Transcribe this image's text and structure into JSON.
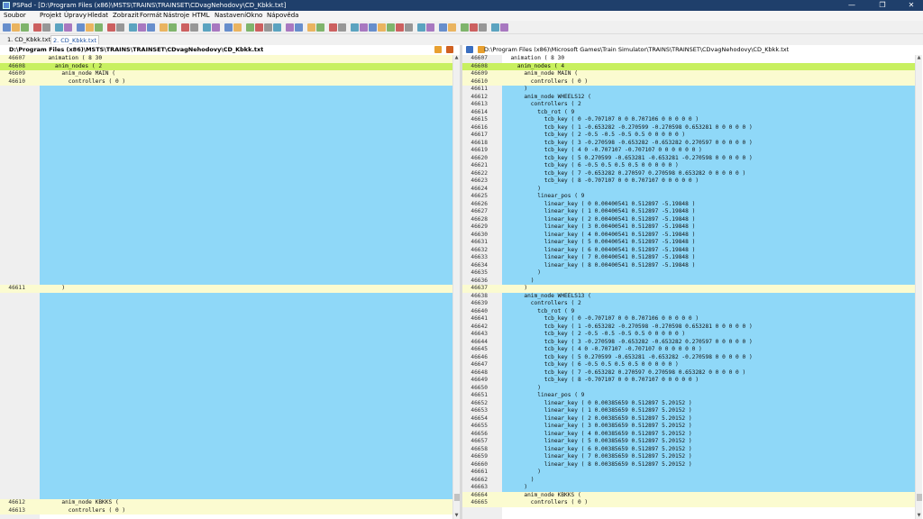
{
  "window": {
    "app_name": "PSPad",
    "title": "PSPad - [D:\\Program Files (x86)\\MSTS\\TRAINS\\TRAINSET\\CDvagNehodovy\\CD_Kbkk.txt]",
    "minimize": "—",
    "maximize": "❐",
    "close": "✕"
  },
  "menu": [
    "Soubor",
    "Projekt",
    "Úpravy",
    "Hledat",
    "Zobrazit",
    "Formát",
    "Nástroje",
    "HTML",
    "Nastavení",
    "Okno",
    "Nápověda"
  ],
  "toolbar_icons": [
    "new-file-icon",
    "open-file-icon",
    "save-icon",
    "save-all-icon",
    "print-icon",
    "print-preview-icon",
    "copy-icon",
    "paste-icon",
    "cut-icon",
    "find-icon",
    "replace-icon",
    "wrap-icon",
    "comment-icon",
    "uncomment-icon",
    "indent-icon",
    "outdent-icon",
    "ftp-icon",
    "browser-icon",
    "bookmark-icon",
    "delete-icon",
    "undo-icon",
    "redo-icon",
    "code-icon",
    "tool-icon",
    "star-icon",
    "column-icon",
    "macro-icon",
    "trans-icon",
    "case-icon",
    "format-icon",
    "clip-icon",
    "link-icon",
    "compare-icon",
    "sync-icon",
    "nav-icon",
    "book-icon",
    "color-icon",
    "grid-icon",
    "spell-icon",
    "script-icon",
    "file-icon",
    "send-icon",
    "lock-icon",
    "unlock-icon",
    "table-icon",
    "fold-icon",
    "unfold-icon",
    "check-icon",
    "run-icon"
  ],
  "tabs": [
    {
      "label": "1. CD_Kbkk.txt",
      "active": false
    },
    {
      "label": "2. CD_Kbkk.txt",
      "active": true
    }
  ],
  "colors": {
    "blue": "#8fd8f8",
    "green": "#c8f060",
    "yellow": "#fbfbd0",
    "white": "#ffffff"
  },
  "left_pane": {
    "path": "D:\\Program Files (x86)\\MSTS\\TRAINS\\TRAINSET\\CDvagNehodovy\\CD_Kbkk.txt",
    "rows": [
      {
        "n": "46607",
        "t": "  animation ( 8 30",
        "c": "yellow"
      },
      {
        "n": "46608",
        "t": "    anim_nodes ( 2",
        "c": "green"
      },
      {
        "n": "46609",
        "t": "      anim_node MAIN (",
        "c": "yellow"
      },
      {
        "n": "46610",
        "t": "        controllers ( 0 )",
        "c": "yellow"
      },
      {
        "n": "",
        "t": "",
        "c": "blue"
      },
      {
        "n": "",
        "t": "",
        "c": "blue"
      },
      {
        "n": "",
        "t": "",
        "c": "blue"
      },
      {
        "n": "",
        "t": "",
        "c": "blue"
      },
      {
        "n": "",
        "t": "",
        "c": "blue"
      },
      {
        "n": "",
        "t": "",
        "c": "blue"
      },
      {
        "n": "",
        "t": "",
        "c": "blue"
      },
      {
        "n": "",
        "t": "",
        "c": "blue"
      },
      {
        "n": "",
        "t": "",
        "c": "blue"
      },
      {
        "n": "",
        "t": "",
        "c": "blue"
      },
      {
        "n": "",
        "t": "",
        "c": "blue"
      },
      {
        "n": "",
        "t": "",
        "c": "blue"
      },
      {
        "n": "",
        "t": "",
        "c": "blue"
      },
      {
        "n": "",
        "t": "",
        "c": "blue"
      },
      {
        "n": "",
        "t": "",
        "c": "blue"
      },
      {
        "n": "",
        "t": "",
        "c": "blue"
      },
      {
        "n": "",
        "t": "",
        "c": "blue"
      },
      {
        "n": "",
        "t": "",
        "c": "blue"
      },
      {
        "n": "",
        "t": "",
        "c": "blue"
      },
      {
        "n": "",
        "t": "",
        "c": "blue"
      },
      {
        "n": "",
        "t": "",
        "c": "blue"
      },
      {
        "n": "",
        "t": "",
        "c": "blue"
      },
      {
        "n": "",
        "t": "",
        "c": "blue"
      },
      {
        "n": "",
        "t": "",
        "c": "blue"
      },
      {
        "n": "",
        "t": "",
        "c": "blue"
      },
      {
        "n": "",
        "t": "",
        "c": "blue"
      },
      {
        "n": "46611",
        "t": "      )",
        "c": "yellow"
      },
      {
        "n": "",
        "t": "",
        "c": "blue"
      },
      {
        "n": "",
        "t": "",
        "c": "blue"
      },
      {
        "n": "",
        "t": "",
        "c": "blue"
      },
      {
        "n": "",
        "t": "",
        "c": "blue"
      },
      {
        "n": "",
        "t": "",
        "c": "blue"
      },
      {
        "n": "",
        "t": "",
        "c": "blue"
      },
      {
        "n": "",
        "t": "",
        "c": "blue"
      },
      {
        "n": "",
        "t": "",
        "c": "blue"
      },
      {
        "n": "",
        "t": "",
        "c": "blue"
      },
      {
        "n": "",
        "t": "",
        "c": "blue"
      },
      {
        "n": "",
        "t": "",
        "c": "blue"
      },
      {
        "n": "",
        "t": "",
        "c": "blue"
      },
      {
        "n": "",
        "t": "",
        "c": "blue"
      },
      {
        "n": "",
        "t": "",
        "c": "blue"
      },
      {
        "n": "",
        "t": "",
        "c": "blue"
      },
      {
        "n": "",
        "t": "",
        "c": "blue"
      },
      {
        "n": "",
        "t": "",
        "c": "blue"
      },
      {
        "n": "",
        "t": "",
        "c": "blue"
      },
      {
        "n": "",
        "t": "",
        "c": "blue"
      },
      {
        "n": "",
        "t": "",
        "c": "blue"
      },
      {
        "n": "",
        "t": "",
        "c": "blue"
      },
      {
        "n": "",
        "t": "",
        "c": "blue"
      },
      {
        "n": "",
        "t": "",
        "c": "blue"
      },
      {
        "n": "",
        "t": "",
        "c": "blue"
      },
      {
        "n": "",
        "t": "",
        "c": "blue"
      },
      {
        "n": "",
        "t": "",
        "c": "blue"
      },
      {
        "n": "",
        "t": "",
        "c": "blue"
      },
      {
        "n": "46612",
        "t": "      anim_node KBKKS (",
        "c": "yellow"
      },
      {
        "n": "46613",
        "t": "        controllers ( 0 )",
        "c": "yellow"
      }
    ]
  },
  "right_pane": {
    "path": "D:\\Program Files (x86)\\Microsoft Games\\Train Simulator\\TRAINS\\TRAINSET\\CDvagNehodovy\\CD_Kbkk.txt",
    "rows": [
      {
        "n": "46607",
        "t": "  animation ( 8 30",
        "c": "white"
      },
      {
        "n": "46608",
        "t": "    anim_nodes ( 4",
        "c": "green"
      },
      {
        "n": "46609",
        "t": "      anim_node MAIN (",
        "c": "yellow"
      },
      {
        "n": "46610",
        "t": "        controllers ( 0 )",
        "c": "yellow"
      },
      {
        "n": "46611",
        "t": "      )",
        "c": "blue"
      },
      {
        "n": "46612",
        "t": "      anim_node WHEELS12 (",
        "c": "blue"
      },
      {
        "n": "46613",
        "t": "        controllers ( 2",
        "c": "blue"
      },
      {
        "n": "46614",
        "t": "          tcb_rot ( 9",
        "c": "blue"
      },
      {
        "n": "46615",
        "t": "            tcb_key ( 0 -0.707107 0 0 0.707106 0 0 0 0 0 )",
        "c": "blue"
      },
      {
        "n": "46616",
        "t": "            tcb_key ( 1 -0.653282 -0.270599 -0.270598 0.653281 0 0 0 0 0 )",
        "c": "blue"
      },
      {
        "n": "46617",
        "t": "            tcb_key ( 2 -0.5 -0.5 -0.5 0.5 0 0 0 0 0 )",
        "c": "blue"
      },
      {
        "n": "46618",
        "t": "            tcb_key ( 3 -0.270598 -0.653282 -0.653282 0.270597 0 0 0 0 0 )",
        "c": "blue"
      },
      {
        "n": "46619",
        "t": "            tcb_key ( 4 0 -0.707107 -0.707107 0 0 0 0 0 0 )",
        "c": "blue"
      },
      {
        "n": "46620",
        "t": "            tcb_key ( 5 0.270599 -0.653281 -0.653281 -0.270598 0 0 0 0 0 )",
        "c": "blue"
      },
      {
        "n": "46621",
        "t": "            tcb_key ( 6 -0.5 0.5 0.5 0.5 0 0 0 0 0 )",
        "c": "blue"
      },
      {
        "n": "46622",
        "t": "            tcb_key ( 7 -0.653282 0.270597 0.270598 0.653282 0 0 0 0 0 )",
        "c": "blue"
      },
      {
        "n": "46623",
        "t": "            tcb_key ( 8 -0.707107 0 0 0.707107 0 0 0 0 0 )",
        "c": "blue"
      },
      {
        "n": "46624",
        "t": "          )",
        "c": "blue"
      },
      {
        "n": "46625",
        "t": "          linear_pos ( 9",
        "c": "blue"
      },
      {
        "n": "46626",
        "t": "            linear_key ( 0 0.00400541 0.512897 -5.19848 )",
        "c": "blue"
      },
      {
        "n": "46627",
        "t": "            linear_key ( 1 0.00400541 0.512897 -5.19848 )",
        "c": "blue"
      },
      {
        "n": "46628",
        "t": "            linear_key ( 2 0.00400541 0.512897 -5.19848 )",
        "c": "blue"
      },
      {
        "n": "46629",
        "t": "            linear_key ( 3 0.00400541 0.512897 -5.19848 )",
        "c": "blue"
      },
      {
        "n": "46630",
        "t": "            linear_key ( 4 0.00400541 0.512897 -5.19848 )",
        "c": "blue"
      },
      {
        "n": "46631",
        "t": "            linear_key ( 5 0.00400541 0.512897 -5.19848 )",
        "c": "blue"
      },
      {
        "n": "46632",
        "t": "            linear_key ( 6 0.00400541 0.512897 -5.19848 )",
        "c": "blue"
      },
      {
        "n": "46633",
        "t": "            linear_key ( 7 0.00400541 0.512897 -5.19848 )",
        "c": "blue"
      },
      {
        "n": "46634",
        "t": "            linear_key ( 8 0.00400541 0.512897 -5.19848 )",
        "c": "blue"
      },
      {
        "n": "46635",
        "t": "          )",
        "c": "blue"
      },
      {
        "n": "46636",
        "t": "        )",
        "c": "blue"
      },
      {
        "n": "46637",
        "t": "      )",
        "c": "yellow"
      },
      {
        "n": "46638",
        "t": "      anim_node WHEELS13 (",
        "c": "blue"
      },
      {
        "n": "46639",
        "t": "        controllers ( 2",
        "c": "blue"
      },
      {
        "n": "46640",
        "t": "          tcb_rot ( 9",
        "c": "blue"
      },
      {
        "n": "46641",
        "t": "            tcb_key ( 0 -0.707107 0 0 0.707106 0 0 0 0 0 )",
        "c": "blue"
      },
      {
        "n": "46642",
        "t": "            tcb_key ( 1 -0.653282 -0.270598 -0.270598 0.653281 0 0 0 0 0 )",
        "c": "blue"
      },
      {
        "n": "46643",
        "t": "            tcb_key ( 2 -0.5 -0.5 -0.5 0.5 0 0 0 0 0 )",
        "c": "blue"
      },
      {
        "n": "46644",
        "t": "            tcb_key ( 3 -0.270598 -0.653282 -0.653282 0.270597 0 0 0 0 0 )",
        "c": "blue"
      },
      {
        "n": "46645",
        "t": "            tcb_key ( 4 0 -0.707107 -0.707107 0 0 0 0 0 0 )",
        "c": "blue"
      },
      {
        "n": "46646",
        "t": "            tcb_key ( 5 0.270599 -0.653281 -0.653282 -0.270598 0 0 0 0 0 )",
        "c": "blue"
      },
      {
        "n": "46647",
        "t": "            tcb_key ( 6 -0.5 0.5 0.5 0.5 0 0 0 0 0 )",
        "c": "blue"
      },
      {
        "n": "46648",
        "t": "            tcb_key ( 7 -0.653282 0.270597 0.270598 0.653282 0 0 0 0 0 )",
        "c": "blue"
      },
      {
        "n": "46649",
        "t": "            tcb_key ( 8 -0.707107 0 0 0.707107 0 0 0 0 0 )",
        "c": "blue"
      },
      {
        "n": "46650",
        "t": "          )",
        "c": "blue"
      },
      {
        "n": "46651",
        "t": "          linear_pos ( 9",
        "c": "blue"
      },
      {
        "n": "46652",
        "t": "            linear_key ( 0 0.00385659 0.512897 5.20152 )",
        "c": "blue"
      },
      {
        "n": "46653",
        "t": "            linear_key ( 1 0.00385659 0.512897 5.20152 )",
        "c": "blue"
      },
      {
        "n": "46654",
        "t": "            linear_key ( 2 0.00385659 0.512897 5.20152 )",
        "c": "blue"
      },
      {
        "n": "46655",
        "t": "            linear_key ( 3 0.00385659 0.512897 5.20152 )",
        "c": "blue"
      },
      {
        "n": "46656",
        "t": "            linear_key ( 4 0.00385659 0.512897 5.20152 )",
        "c": "blue"
      },
      {
        "n": "46657",
        "t": "            linear_key ( 5 0.00385659 0.512897 5.20152 )",
        "c": "blue"
      },
      {
        "n": "46658",
        "t": "            linear_key ( 6 0.00385659 0.512897 5.20152 )",
        "c": "blue"
      },
      {
        "n": "46659",
        "t": "            linear_key ( 7 0.00385659 0.512897 5.20152 )",
        "c": "blue"
      },
      {
        "n": "46660",
        "t": "            linear_key ( 8 0.00385659 0.512897 5.20152 )",
        "c": "blue"
      },
      {
        "n": "46661",
        "t": "          )",
        "c": "blue"
      },
      {
        "n": "46662",
        "t": "        )",
        "c": "blue"
      },
      {
        "n": "46663",
        "t": "      )",
        "c": "blue"
      },
      {
        "n": "46664",
        "t": "      anim_node KBKKS (",
        "c": "yellow"
      },
      {
        "n": "46665",
        "t": "        controllers ( 0 )",
        "c": "yellow"
      }
    ]
  }
}
